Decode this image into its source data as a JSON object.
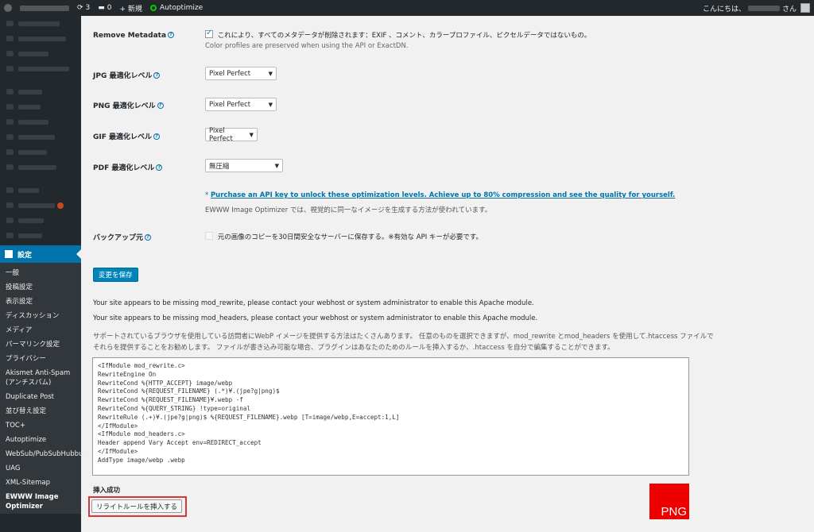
{
  "adminbar": {
    "updates_count": "3",
    "comments_count": "0",
    "new_label": "+ 新規",
    "autoptimize_label": "Autoptimize",
    "greeting": "こんにちは、",
    "greeting_suffix": "さん"
  },
  "sidebar": {
    "current_label": "設定",
    "submenu": [
      "一般",
      "投稿設定",
      "表示設定",
      "ディスカッション",
      "メディア",
      "パーマリンク設定",
      "プライバシー",
      "Akismet Anti-Spam (アンチスパム)",
      "Duplicate Post",
      "並び替え設定",
      "TOC+",
      "Autoptimize",
      "WebSub/PubSubHubbub",
      "UAG",
      "XML-Sitemap",
      "EWWW Image Optimizer"
    ]
  },
  "settings": {
    "remove_metadata_label": "Remove Metadata",
    "remove_metadata_text": "これにより、すべてのメタデータが削除されます：EXIF 、コメント、カラープロファイル、ピクセルデータではないもの。",
    "remove_metadata_desc": "Color profiles are preserved when using the API or ExactDN.",
    "jpg_label": "JPG 最適化レベル",
    "jpg_value": "Pixel Perfect",
    "png_label": "PNG 最適化レベル",
    "png_value": "Pixel Perfect",
    "gif_label": "GIF 最適化レベル",
    "gif_value": "Pixel Perfect",
    "pdf_label": "PDF 最適化レベル",
    "pdf_value": "無圧縮",
    "api_link": "Purchase an API key to unlock these optimization levels. Achieve up to 80% compression and see the quality for yourself.",
    "api_note": "EWWW Image Optimizer では、視覚的に同一なイメージを生成する方法が使われています。",
    "backup_label": "バックアップ元",
    "backup_text": "元の画像のコピーを30日間安全なサーバーに保存する。※有効な API キーが必要です。",
    "save_button": "変更を保存"
  },
  "webp": {
    "notice_rewrite": "Your site appears to be missing mod_rewrite, please contact your webhost or system administrator to enable this Apache module.",
    "notice_headers": "Your site appears to be missing mod_headers, please contact your webhost or system administrator to enable this Apache module.",
    "description_line1": "サポートされているブラウザを使用している訪問者にWebP イメージを提供する方法はたくさんあります。 任意のものを選択できますが、mod_rewrite とmod_headers を使用して.htaccess ファイルで",
    "description_line2": "それらを提供することをお勧めします。 ファイルが書き込み可能な場合、プラグインはあなたのためのルールを挿入するか、.htaccess を自分で編集することができます。",
    "code_lines": [
      "<IfModule mod_rewrite.c>",
      "RewriteEngine On",
      "RewriteCond %{HTTP_ACCEPT} image/webp",
      "RewriteCond %{REQUEST_FILENAME} (.*)¥.(jpe?g|png)$",
      "RewriteCond %{REQUEST_FILENAME}¥.webp -f",
      "RewriteCond %{QUERY_STRING} !type=original",
      "RewriteRule (.+)¥.(jpe?g|png)$ %{REQUEST_FILENAME}.webp [T=image/webp,E=accept:1,L]",
      "</IfModule>",
      "<IfModule mod_headers.c>",
      "Header append Vary Accept env=REDIRECT_accept",
      "</IfModule>",
      "AddType image/webp .webp"
    ],
    "insert_success": "挿入成功",
    "insert_button": "リライトルールを挿入する",
    "badge": "PNG"
  }
}
